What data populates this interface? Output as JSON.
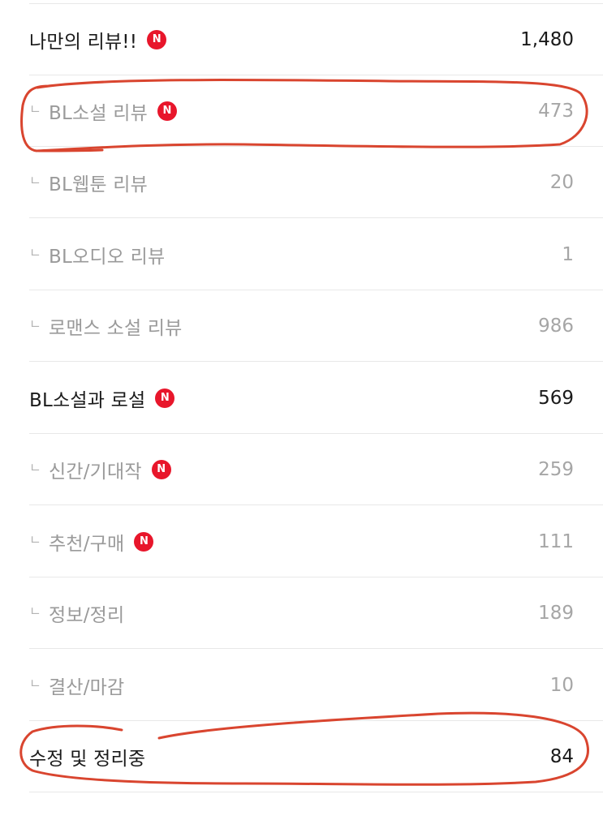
{
  "categories": [
    {
      "label": "나만의 리뷰!!",
      "count": "1,480",
      "new": true,
      "child": false,
      "new_badge": "N"
    },
    {
      "label": "BL소설 리뷰",
      "count": "473",
      "new": true,
      "child": true,
      "new_badge": "N",
      "branch": "ㄴ"
    },
    {
      "label": "BL웹툰 리뷰",
      "count": "20",
      "new": false,
      "child": true,
      "branch": "ㄴ"
    },
    {
      "label": "BL오디오 리뷰",
      "count": "1",
      "new": false,
      "child": true,
      "branch": "ㄴ"
    },
    {
      "label": "로맨스 소설 리뷰",
      "count": "986",
      "new": false,
      "child": true,
      "branch": "ㄴ"
    },
    {
      "label": "BL소설과 로설",
      "count": "569",
      "new": true,
      "child": false,
      "new_badge": "N"
    },
    {
      "label": "신간/기대작",
      "count": "259",
      "new": true,
      "child": true,
      "new_badge": "N",
      "branch": "ㄴ"
    },
    {
      "label": "추천/구매",
      "count": "111",
      "new": true,
      "child": true,
      "new_badge": "N",
      "branch": "ㄴ"
    },
    {
      "label": "정보/정리",
      "count": "189",
      "new": false,
      "child": true,
      "branch": "ㄴ"
    },
    {
      "label": "결산/마감",
      "count": "10",
      "new": false,
      "child": true,
      "branch": "ㄴ"
    },
    {
      "label": "수정 및 정리중",
      "count": "84",
      "new": false,
      "child": false
    }
  ],
  "colors": {
    "new_badge": "#e8162b",
    "annotation": "#d9452f",
    "parent_text": "#1a1a1a",
    "child_text": "#9a9a9a"
  }
}
